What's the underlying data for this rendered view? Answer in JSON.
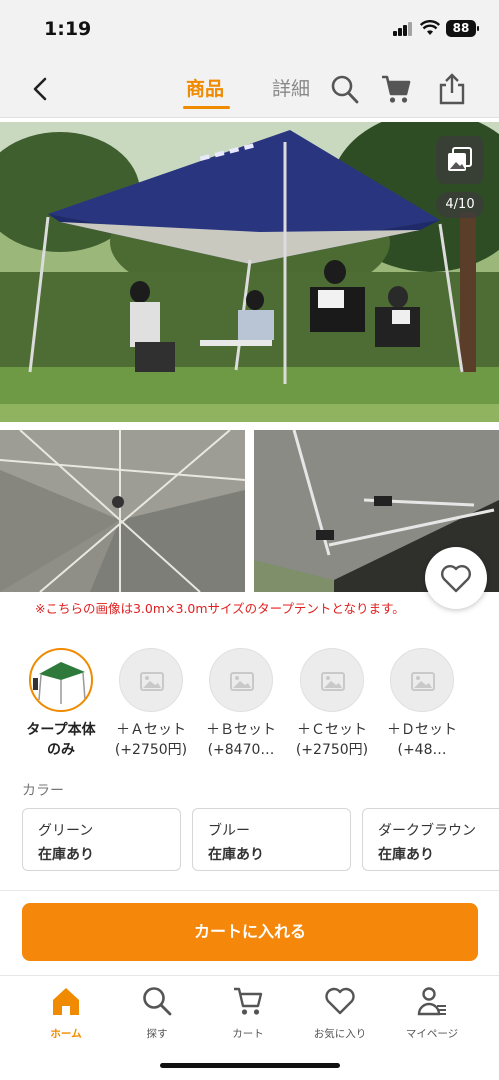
{
  "status_bar": {
    "time": "1:19",
    "battery": "88"
  },
  "nav": {
    "tabs": [
      {
        "label": "商品",
        "active": true
      },
      {
        "label": "詳細",
        "active": false
      }
    ],
    "icons": [
      "back-chevron-icon",
      "search-icon",
      "cart-icon",
      "share-icon"
    ]
  },
  "hero": {
    "counter": "4/10",
    "gallery_icon": "image-gallery-icon"
  },
  "notice": "※こちらの画像は3.0m×3.0mサイズのタープテントとなります。",
  "variations": [
    {
      "name": "タープ本体",
      "price": "のみ",
      "selected": true
    },
    {
      "name": "＋Ａセット",
      "price": "(+2750円)",
      "selected": false
    },
    {
      "name": "＋Ｂセット",
      "price": "(+8470…",
      "selected": false
    },
    {
      "name": "＋Ｃセット",
      "price": "(+2750円)",
      "selected": false
    },
    {
      "name": "＋Ｄセット",
      "price": "(+48…",
      "selected": false
    }
  ],
  "color": {
    "label": "カラー",
    "options": [
      {
        "name": "グリーン",
        "stock": "在庫あり"
      },
      {
        "name": "ブルー",
        "stock": "在庫あり"
      },
      {
        "name": "ダークブラウン",
        "stock": "在庫あり"
      }
    ]
  },
  "cart_button": "カートに入れる",
  "bottom_nav": [
    {
      "label": "ホーム",
      "icon": "home-icon",
      "active": true
    },
    {
      "label": "探す",
      "icon": "search-icon",
      "active": false
    },
    {
      "label": "カート",
      "icon": "cart-icon",
      "active": false
    },
    {
      "label": "お気に入り",
      "icon": "heart-icon",
      "active": false
    },
    {
      "label": "マイページ",
      "icon": "user-icon",
      "active": false
    }
  ],
  "colors": {
    "accent": "#f08a00",
    "cart_button": "#f5870a",
    "notice": "#e02020"
  }
}
